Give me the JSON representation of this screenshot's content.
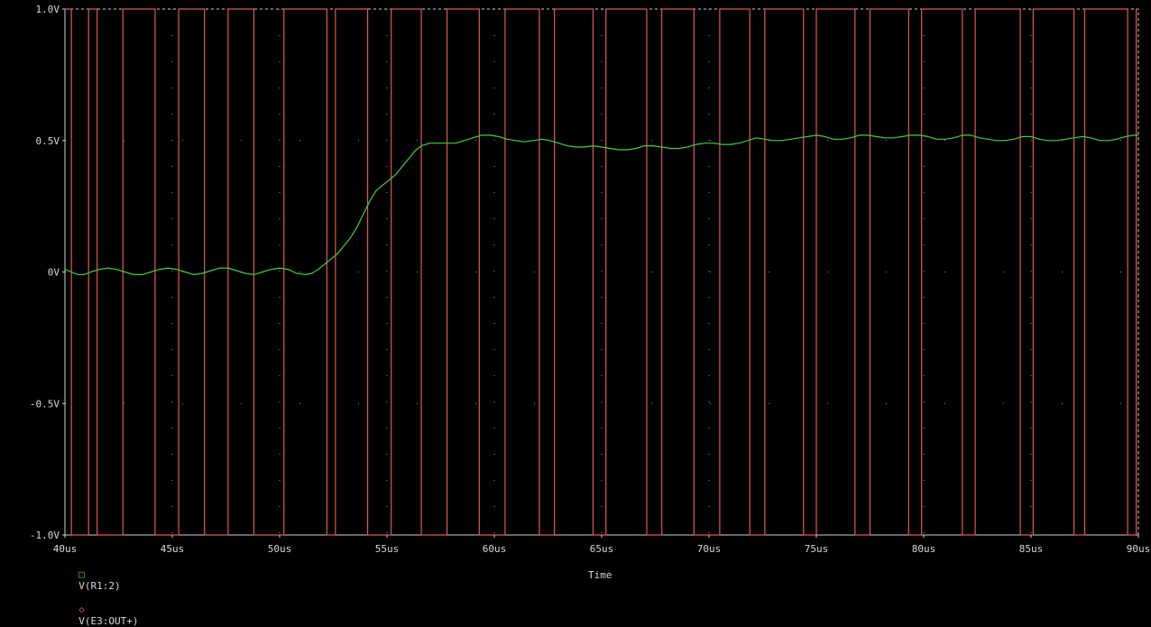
{
  "chart_data": {
    "type": "line",
    "xlabel": "Time",
    "x_unit": "us",
    "xlim": [
      40,
      90
    ],
    "ylim": [
      -1.0,
      1.0
    ],
    "grid": true,
    "x_ticks": [
      {
        "v": 40,
        "label": "40us"
      },
      {
        "v": 45,
        "label": "45us"
      },
      {
        "v": 50,
        "label": "50us"
      },
      {
        "v": 55,
        "label": "55us"
      },
      {
        "v": 60,
        "label": "60us"
      },
      {
        "v": 65,
        "label": "65us"
      },
      {
        "v": 70,
        "label": "70us"
      },
      {
        "v": 75,
        "label": "75us"
      },
      {
        "v": 80,
        "label": "80us"
      },
      {
        "v": 85,
        "label": "85us"
      },
      {
        "v": 90,
        "label": "90us"
      }
    ],
    "y_ticks": [
      {
        "v": 1.0,
        "label": "1.0V"
      },
      {
        "v": 0.5,
        "label": "0.5V"
      },
      {
        "v": 0,
        "label": "0V"
      },
      {
        "v": -0.5,
        "label": "-0.5V"
      },
      {
        "v": -1.0,
        "label": "-1.0V"
      }
    ],
    "series": [
      {
        "name": "V(R1:2)",
        "marker": "square",
        "color": "#3cd23c",
        "points": [
          [
            40.0,
            0.01
          ],
          [
            40.3,
            0.0
          ],
          [
            40.6,
            -0.01
          ],
          [
            40.9,
            -0.01
          ],
          [
            41.2,
            0.0
          ],
          [
            41.6,
            0.01
          ],
          [
            42.0,
            0.015
          ],
          [
            42.4,
            0.01
          ],
          [
            42.8,
            0.0
          ],
          [
            43.2,
            -0.01
          ],
          [
            43.6,
            -0.01
          ],
          [
            44.0,
            0.0
          ],
          [
            44.4,
            0.01
          ],
          [
            44.8,
            0.015
          ],
          [
            45.2,
            0.01
          ],
          [
            45.6,
            0.0
          ],
          [
            46.0,
            -0.01
          ],
          [
            46.4,
            -0.005
          ],
          [
            46.8,
            0.005
          ],
          [
            47.2,
            0.015
          ],
          [
            47.6,
            0.015
          ],
          [
            48.0,
            0.005
          ],
          [
            48.4,
            -0.005
          ],
          [
            48.8,
            -0.01
          ],
          [
            49.2,
            0.0
          ],
          [
            49.6,
            0.01
          ],
          [
            50.0,
            0.015
          ],
          [
            50.4,
            0.01
          ],
          [
            50.8,
            -0.005
          ],
          [
            51.2,
            -0.01
          ],
          [
            51.5,
            -0.005
          ],
          [
            51.8,
            0.01
          ],
          [
            52.1,
            0.03
          ],
          [
            52.4,
            0.05
          ],
          [
            52.7,
            0.07
          ],
          [
            53.0,
            0.1
          ],
          [
            53.3,
            0.13
          ],
          [
            53.6,
            0.17
          ],
          [
            53.9,
            0.22
          ],
          [
            54.2,
            0.27
          ],
          [
            54.5,
            0.31
          ],
          [
            54.8,
            0.33
          ],
          [
            55.1,
            0.35
          ],
          [
            55.4,
            0.37
          ],
          [
            55.7,
            0.4
          ],
          [
            56.0,
            0.43
          ],
          [
            56.3,
            0.46
          ],
          [
            56.6,
            0.48
          ],
          [
            57.0,
            0.49
          ],
          [
            57.4,
            0.49
          ],
          [
            57.8,
            0.49
          ],
          [
            58.2,
            0.49
          ],
          [
            58.6,
            0.5
          ],
          [
            59.0,
            0.51
          ],
          [
            59.4,
            0.52
          ],
          [
            59.8,
            0.52
          ],
          [
            60.2,
            0.515
          ],
          [
            60.6,
            0.505
          ],
          [
            61.0,
            0.5
          ],
          [
            61.4,
            0.495
          ],
          [
            61.8,
            0.5
          ],
          [
            62.2,
            0.505
          ],
          [
            62.6,
            0.5
          ],
          [
            63.0,
            0.49
          ],
          [
            63.4,
            0.48
          ],
          [
            63.8,
            0.475
          ],
          [
            64.2,
            0.475
          ],
          [
            64.6,
            0.48
          ],
          [
            65.0,
            0.475
          ],
          [
            65.4,
            0.47
          ],
          [
            65.8,
            0.465
          ],
          [
            66.2,
            0.465
          ],
          [
            66.6,
            0.47
          ],
          [
            67.0,
            0.48
          ],
          [
            67.4,
            0.48
          ],
          [
            67.8,
            0.475
          ],
          [
            68.2,
            0.47
          ],
          [
            68.6,
            0.47
          ],
          [
            69.0,
            0.475
          ],
          [
            69.4,
            0.485
          ],
          [
            69.8,
            0.49
          ],
          [
            70.2,
            0.49
          ],
          [
            70.6,
            0.485
          ],
          [
            71.0,
            0.485
          ],
          [
            71.4,
            0.49
          ],
          [
            71.8,
            0.5
          ],
          [
            72.2,
            0.51
          ],
          [
            72.6,
            0.505
          ],
          [
            73.0,
            0.5
          ],
          [
            73.4,
            0.5
          ],
          [
            73.8,
            0.505
          ],
          [
            74.2,
            0.51
          ],
          [
            74.6,
            0.515
          ],
          [
            75.0,
            0.52
          ],
          [
            75.4,
            0.515
          ],
          [
            75.8,
            0.505
          ],
          [
            76.2,
            0.505
          ],
          [
            76.6,
            0.51
          ],
          [
            77.0,
            0.52
          ],
          [
            77.4,
            0.52
          ],
          [
            77.8,
            0.515
          ],
          [
            78.2,
            0.51
          ],
          [
            78.6,
            0.51
          ],
          [
            79.0,
            0.515
          ],
          [
            79.4,
            0.52
          ],
          [
            79.8,
            0.52
          ],
          [
            80.2,
            0.515
          ],
          [
            80.6,
            0.505
          ],
          [
            81.0,
            0.505
          ],
          [
            81.4,
            0.51
          ],
          [
            81.8,
            0.52
          ],
          [
            82.2,
            0.52
          ],
          [
            82.6,
            0.51
          ],
          [
            83.0,
            0.505
          ],
          [
            83.4,
            0.5
          ],
          [
            83.8,
            0.5
          ],
          [
            84.2,
            0.505
          ],
          [
            84.6,
            0.515
          ],
          [
            85.0,
            0.515
          ],
          [
            85.4,
            0.505
          ],
          [
            85.8,
            0.5
          ],
          [
            86.2,
            0.5
          ],
          [
            86.6,
            0.505
          ],
          [
            87.0,
            0.51
          ],
          [
            87.4,
            0.515
          ],
          [
            87.8,
            0.51
          ],
          [
            88.2,
            0.5
          ],
          [
            88.6,
            0.5
          ],
          [
            89.0,
            0.505
          ],
          [
            89.4,
            0.515
          ],
          [
            89.8,
            0.52
          ],
          [
            90.0,
            0.52
          ]
        ]
      },
      {
        "name": "V(E3:OUT+)",
        "marker": "diamond",
        "color": "#e05a50",
        "high": 1.0,
        "low": -1.0,
        "initial": 1.0,
        "toggle_times": [
          40.3,
          41.1,
          41.5,
          42.7,
          44.2,
          45.3,
          46.5,
          47.6,
          48.8,
          50.2,
          52.2,
          52.6,
          54.1,
          55.2,
          56.6,
          57.8,
          59.3,
          60.5,
          62.1,
          62.8,
          64.6,
          65.2,
          67.1,
          67.8,
          69.3,
          70.5,
          71.9,
          72.6,
          74.4,
          75.0,
          76.8,
          77.5,
          79.3,
          79.9,
          81.8,
          82.4,
          84.5,
          85.1,
          87.0,
          87.5,
          89.5,
          89.9
        ]
      }
    ]
  }
}
